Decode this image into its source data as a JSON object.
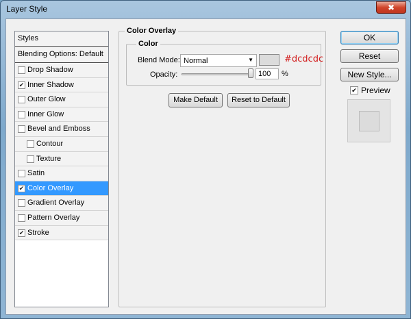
{
  "window": {
    "title": "Layer Style",
    "close_icon": "✖"
  },
  "styles_list": {
    "header": "Styles",
    "blending_options": "Blending Options: Default",
    "items": [
      {
        "label": "Drop Shadow",
        "checked": false,
        "sub": false,
        "selected": false
      },
      {
        "label": "Inner Shadow",
        "checked": true,
        "sub": false,
        "selected": false
      },
      {
        "label": "Outer Glow",
        "checked": false,
        "sub": false,
        "selected": false
      },
      {
        "label": "Inner Glow",
        "checked": false,
        "sub": false,
        "selected": false
      },
      {
        "label": "Bevel and Emboss",
        "checked": false,
        "sub": false,
        "selected": false
      },
      {
        "label": "Contour",
        "checked": false,
        "sub": true,
        "selected": false
      },
      {
        "label": "Texture",
        "checked": false,
        "sub": true,
        "selected": false
      },
      {
        "label": "Satin",
        "checked": false,
        "sub": false,
        "selected": false
      },
      {
        "label": "Color Overlay",
        "checked": true,
        "sub": false,
        "selected": true
      },
      {
        "label": "Gradient Overlay",
        "checked": false,
        "sub": false,
        "selected": false
      },
      {
        "label": "Pattern Overlay",
        "checked": false,
        "sub": false,
        "selected": false
      },
      {
        "label": "Stroke",
        "checked": true,
        "sub": false,
        "selected": false
      }
    ]
  },
  "color_overlay": {
    "group_title": "Color Overlay",
    "subgroup_title": "Color",
    "blend_mode_label": "Blend Mode:",
    "blend_mode_value": "Normal",
    "swatch_color": "#dcdcdc",
    "hex_annotation": "#dcdcdc",
    "opacity_label": "Opacity:",
    "opacity_value": "100",
    "opacity_unit": "%",
    "make_default_label": "Make Default",
    "reset_default_label": "Reset to Default"
  },
  "actions": {
    "ok_label": "OK",
    "reset_label": "Reset",
    "new_style_label": "New Style...",
    "preview_label": "Preview",
    "preview_checked": true
  },
  "colors": {
    "selection": "#3399ff",
    "annotation": "#d21e1e",
    "overlay_color": "#dcdcdc"
  }
}
